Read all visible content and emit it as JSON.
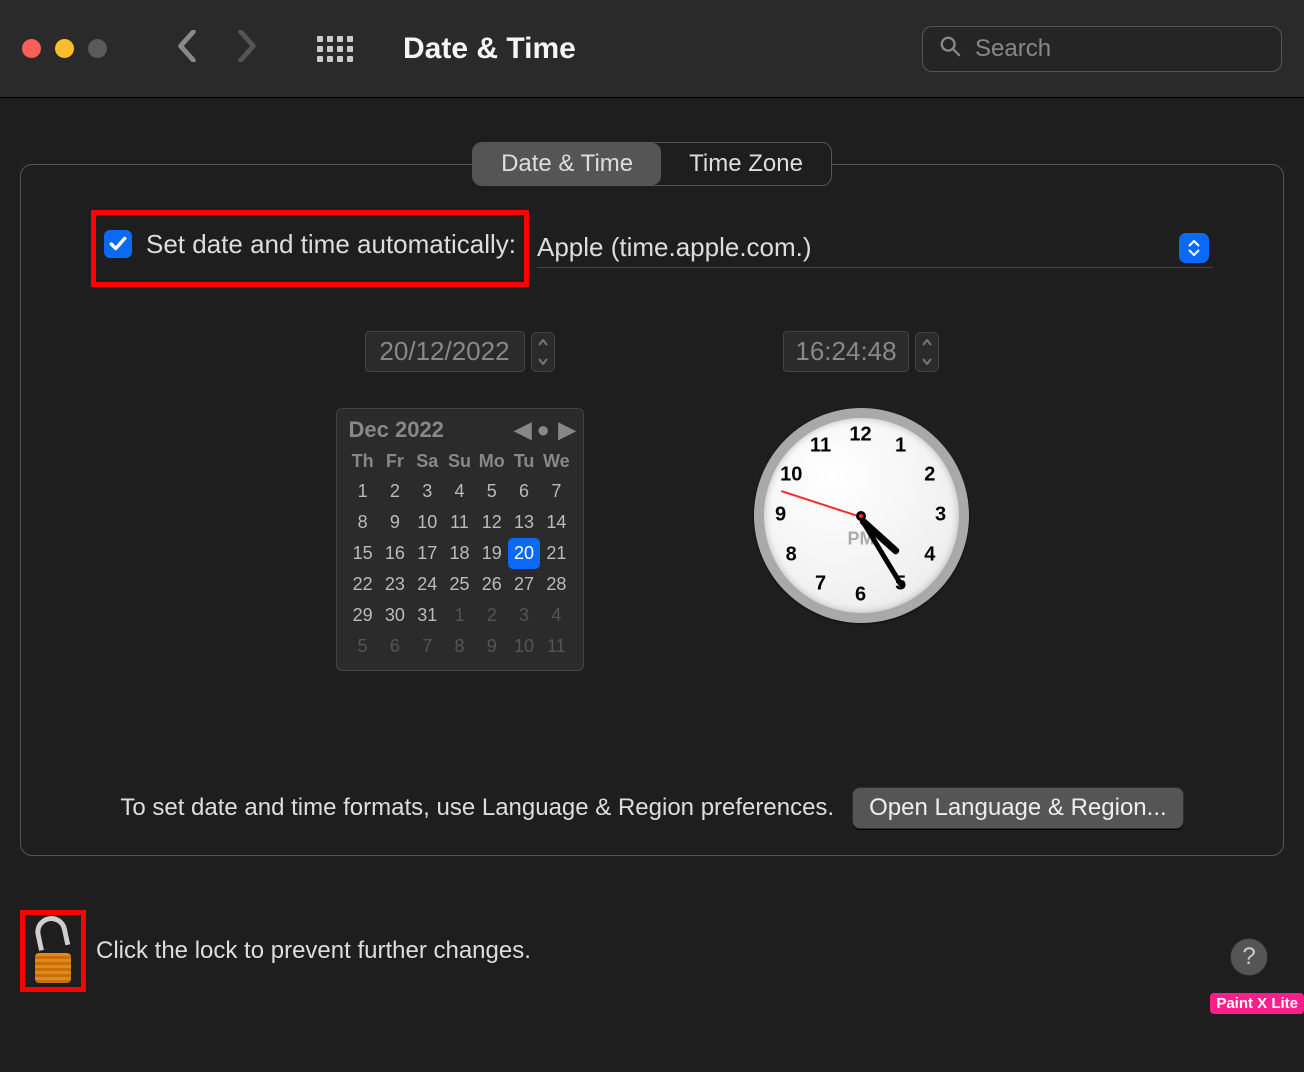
{
  "window": {
    "title": "Date & Time",
    "search_placeholder": "Search"
  },
  "tabs": {
    "date_time": "Date & Time",
    "time_zone": "Time Zone"
  },
  "auto": {
    "checkbox_checked": true,
    "label": "Set date and time automatically:",
    "server": "Apple (time.apple.com.)"
  },
  "date_field": "20/12/2022",
  "time_field": "16:24:48",
  "calendar": {
    "month_label": "Dec 2022",
    "dow": [
      "Th",
      "Fr",
      "Sa",
      "Su",
      "Mo",
      "Tu",
      "We"
    ],
    "weeks": [
      [
        {
          "n": 1
        },
        {
          "n": 2
        },
        {
          "n": 3
        },
        {
          "n": 4
        },
        {
          "n": 5
        },
        {
          "n": 6
        },
        {
          "n": 7
        }
      ],
      [
        {
          "n": 8
        },
        {
          "n": 9
        },
        {
          "n": 10
        },
        {
          "n": 11
        },
        {
          "n": 12
        },
        {
          "n": 13
        },
        {
          "n": 14
        }
      ],
      [
        {
          "n": 15
        },
        {
          "n": 16
        },
        {
          "n": 17
        },
        {
          "n": 18
        },
        {
          "n": 19
        },
        {
          "n": 20,
          "sel": true
        },
        {
          "n": 21
        }
      ],
      [
        {
          "n": 22
        },
        {
          "n": 23
        },
        {
          "n": 24
        },
        {
          "n": 25
        },
        {
          "n": 26
        },
        {
          "n": 27
        },
        {
          "n": 28
        }
      ],
      [
        {
          "n": 29
        },
        {
          "n": 30
        },
        {
          "n": 31
        },
        {
          "n": 1,
          "dim": true
        },
        {
          "n": 2,
          "dim": true
        },
        {
          "n": 3,
          "dim": true
        },
        {
          "n": 4,
          "dim": true
        }
      ],
      [
        {
          "n": 5,
          "dim": true
        },
        {
          "n": 6,
          "dim": true
        },
        {
          "n": 7,
          "dim": true
        },
        {
          "n": 8,
          "dim": true
        },
        {
          "n": 9,
          "dim": true
        },
        {
          "n": 10,
          "dim": true
        },
        {
          "n": 11,
          "dim": true
        }
      ]
    ]
  },
  "clock": {
    "ampm": "PM",
    "hour": 4,
    "minute": 24,
    "second": 48
  },
  "footer": {
    "hint": "To set date and time formats, use Language & Region preferences.",
    "open_btn": "Open Language & Region..."
  },
  "lock": {
    "text": "Click the lock to prevent further changes."
  },
  "help_label": "?",
  "watermark": "Paint X Lite"
}
